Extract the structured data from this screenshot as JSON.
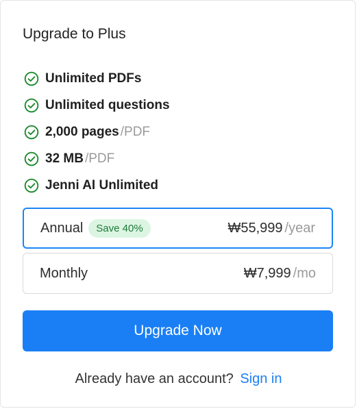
{
  "title": "Upgrade to Plus",
  "features": [
    {
      "strong": "Unlimited PDFs",
      "unit": "",
      "icon": "check-circle-icon"
    },
    {
      "strong": "Unlimited questions",
      "unit": "",
      "icon": "check-circle-icon"
    },
    {
      "strong": "2,000 pages",
      "unit": "/PDF",
      "icon": "check-circle-icon"
    },
    {
      "strong": "32 MB",
      "unit": "/PDF",
      "icon": "check-circle-icon"
    },
    {
      "strong": "Jenni AI Unlimited",
      "unit": "",
      "icon": "check-circle-icon"
    }
  ],
  "plans": {
    "annual": {
      "name": "Annual",
      "badge": "Save 40%",
      "price": "₩55,999",
      "period": "/year",
      "selected": true
    },
    "monthly": {
      "name": "Monthly",
      "price": "₩7,999",
      "period": "/mo",
      "selected": false
    }
  },
  "cta": {
    "label": "Upgrade Now"
  },
  "signin": {
    "prompt": "Already have an account?",
    "link": "Sign in"
  },
  "colors": {
    "accent": "#1a7ff5",
    "check": "#1e8a2e",
    "badge_bg": "#dbf5e2",
    "badge_text": "#1e7a39"
  }
}
